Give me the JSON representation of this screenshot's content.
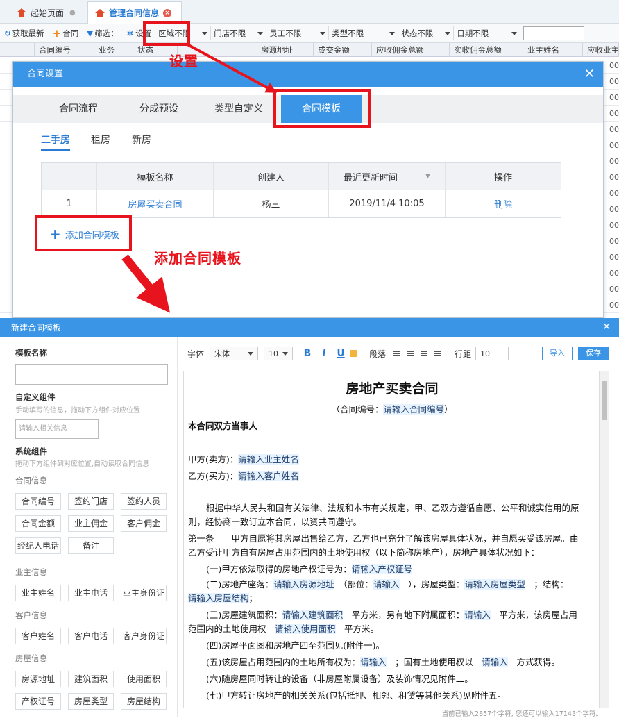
{
  "app": {
    "tabs": [
      {
        "label": "起始页面"
      },
      {
        "label": "管理合同信息"
      }
    ],
    "toolbar": {
      "refresh": "获取最新",
      "add_contract": "合同",
      "filter": "筛选：",
      "settings": "设置",
      "selects": [
        "区域不限",
        "门店不限",
        "员工不限",
        "类型不限",
        "状态不限",
        "日期不限"
      ]
    },
    "grid": {
      "columns": [
        "合同编号",
        "业务",
        "状态",
        "房源地址",
        "成交金额",
        "应收佣金总额",
        "实收佣金总额",
        "业主姓名",
        "应收业主"
      ],
      "row_values": [
        "00",
        "00",
        "00",
        "00",
        "00",
        "00",
        "00",
        "00",
        "00",
        "00",
        "00",
        "00",
        "00",
        "00",
        "00",
        "00",
        "00"
      ]
    }
  },
  "contract_settings": {
    "title": "合同设置",
    "tabs": [
      "合同流程",
      "分成预设",
      "类型自定义",
      "合同模板"
    ],
    "active_tab": "合同模板",
    "subtabs": [
      "二手房",
      "租房",
      "新房"
    ],
    "table": {
      "headers": [
        "模板名称",
        "创建人",
        "最近更新时间",
        "操作"
      ],
      "rows": [
        {
          "no": "1",
          "name": "房屋买卖合同",
          "creator": "杨三",
          "updated": "2019/11/4 10:05",
          "action": "删除"
        }
      ]
    },
    "add_button": "添加合同模板"
  },
  "annotations": {
    "settings": "设置",
    "add": "添加合同模板",
    "color": "#e8141d"
  },
  "new_template": {
    "title": "新建合同模板",
    "name_label": "模板名称",
    "custom_title": "自定义组件",
    "custom_hint": "手动填写的信息，拖动下方组件对应位置",
    "custom_placeholder": "请输入相关信息",
    "system_title": "系统组件",
    "system_hint": "拖动下方组件到对应位置,自动读取合同信息",
    "groups": [
      {
        "label": "合同信息",
        "chips": [
          "合同编号",
          "签约门店",
          "签约人员",
          "合同金额",
          "业主佣金",
          "客户佣金",
          "经纪人电话",
          "备注"
        ]
      },
      {
        "label": "业主信息",
        "chips": [
          "业主姓名",
          "业主电话",
          "业主身份证"
        ]
      },
      {
        "label": "客户信息",
        "chips": [
          "客户姓名",
          "客户电话",
          "客户身份证"
        ]
      },
      {
        "label": "房屋信息",
        "chips": [
          "房源地址",
          "建筑面积",
          "使用面积",
          "产权证号",
          "房屋类型",
          "房屋结构"
        ]
      }
    ],
    "editor": {
      "font_label": "字体",
      "font": "宋体",
      "size": "10",
      "paragraph": "段落",
      "spacing_label": "行距",
      "spacing": "10",
      "import": "导入",
      "save": "保存"
    },
    "document": {
      "title": "房地产买卖合同",
      "subtitle": "（合同编号：请输入合同编号）",
      "lines": [
        "本合同双方当事人",
        "甲方(卖方)：请输入业主姓名",
        "乙方(买方)：请输入客户姓名",
        "根据中华人民共和国有关法律、法规和本市有关规定，甲、乙双方遵循自愿、公平和诚实信用的原",
        "则，经协商一致订立本合同，以资共同遵守。",
        "第一条　　甲方自愿将其房屋出售给乙方，乙方也已充分了解该房屋具体状况，并自愿买受该房屋。由",
        "乙方受让甲方自有房屋占用范围内的土地使用权（以下简称房地产），房地产具体状况如下：",
        "(一)甲方依法取得的房地产权证号为：请输入产权证号",
        "(二)房地产座落：请输入房源地址　（部位：请输入　），房屋类型：请输入房屋类型　；结构：",
        "请输入房屋结构；",
        "(三)房屋建筑面积：请输入建筑面积　平方米，另有地下附属面积：请输入　平方米，该房屋占用",
        "范围内的土地使用权　请输入使用面积　平方米。",
        "(四)房屋平面图和房地产四至范围见(附件一)。",
        "(五)该房屋占用范围内的土地所有权为：请输入　；国有土地使用权以　请输入　方式获得。",
        "(六)随房屋同时转让的设备（非房屋附属设备）及装饰情况见附件二。",
        "(七)甲方转让房地产的相关关系(包括抵押、相邻、租赁等其他关系)见附件五。"
      ]
    },
    "status": "当前已输入2857个字符, 您还可以输入17143个字符。"
  }
}
